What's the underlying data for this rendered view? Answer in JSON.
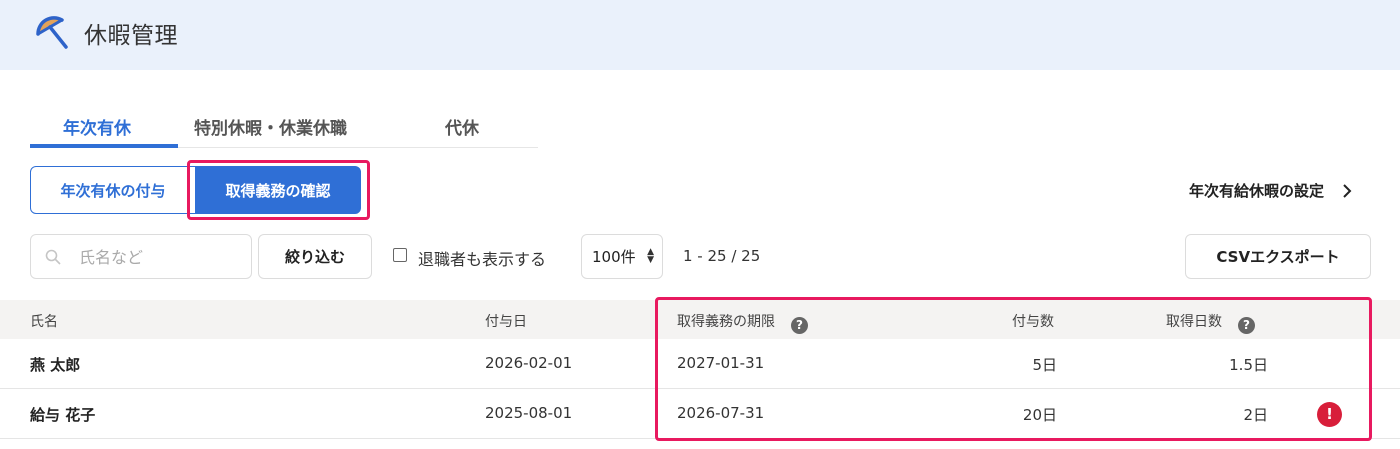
{
  "app": {
    "title": "休暇管理",
    "logo_icon": "umbrella-icon"
  },
  "tabs": [
    {
      "label": "年次有休",
      "active": true
    },
    {
      "label": "特別休暇・休業休職",
      "active": false
    },
    {
      "label": "代休",
      "active": false
    }
  ],
  "segment": {
    "grant_label": "年次有休の付与",
    "check_label": "取得義務の確認",
    "selected": "取得義務の確認"
  },
  "settings_link": {
    "label": "年次有給休暇の設定",
    "icon": "chevron-right-icon"
  },
  "filter": {
    "search_placeholder": "氏名など",
    "search_value": "",
    "search_icon": "search-icon",
    "filter_button": "絞り込む",
    "show_retired_label": "退職者も表示する",
    "show_retired_checked": false,
    "per_page": "100件",
    "count_text": "1 - 25 / 25",
    "csv_button": "CSVエクスポート"
  },
  "table": {
    "headers": {
      "name": "氏名",
      "grant_date": "付与日",
      "deadline": "取得義務の期限",
      "granted_days": "付与数",
      "taken_days": "取得日数",
      "help_glyph": "?"
    },
    "rows": [
      {
        "name": "燕 太郎",
        "grant_date": "2026-02-01",
        "deadline": "2027-01-31",
        "granted_days": "5日",
        "taken_days": "1.5日",
        "alert": false
      },
      {
        "name": "給与 花子",
        "grant_date": "2025-08-01",
        "deadline": "2026-07-31",
        "granted_days": "20日",
        "taken_days": "2日",
        "alert": true,
        "alert_glyph": "!"
      }
    ]
  },
  "colors": {
    "accent": "#2f6fd6",
    "highlight": "#e8195f",
    "alert": "#d81e3a",
    "header_bg": "#eaf1fb"
  }
}
